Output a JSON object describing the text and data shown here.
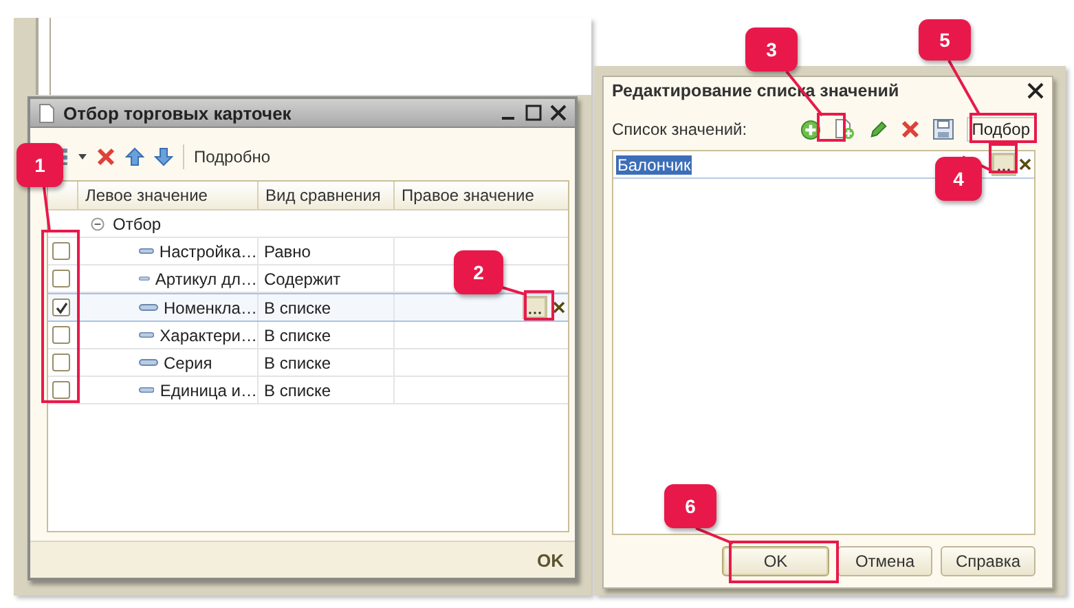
{
  "filter_window": {
    "title": "Отбор торговых карточек",
    "toolbar": {
      "details_button": "Подробно"
    },
    "table": {
      "columns": [
        "Левое значение",
        "Вид сравнения",
        "Правое значение"
      ],
      "group": {
        "label": "Отбор",
        "expanded": true
      },
      "rows": [
        {
          "checked": false,
          "left": "Настройка…",
          "comparison": "Равно",
          "right": "",
          "selected": false
        },
        {
          "checked": false,
          "left": "Артикул дл…",
          "comparison": "Содержит",
          "right": "",
          "selected": false
        },
        {
          "checked": true,
          "left": "Номенкла…",
          "comparison": "В списке",
          "right": "",
          "selected": true
        },
        {
          "checked": false,
          "left": "Характери…",
          "comparison": "В списке",
          "right": "",
          "selected": false
        },
        {
          "checked": false,
          "left": "Серия",
          "comparison": "В списке",
          "right": "",
          "selected": false
        },
        {
          "checked": false,
          "left": "Единица и…",
          "comparison": "В списке",
          "right": "",
          "selected": false
        }
      ]
    },
    "ok_button": "OK"
  },
  "list_window": {
    "title": "Редактирование списка значений",
    "label": "Список значений:",
    "pick_button": "Подбор",
    "items": [
      {
        "value": "Балончик",
        "selected": true
      }
    ],
    "buttons": [
      "OK",
      "Отмена",
      "Справка"
    ]
  },
  "callouts": [
    {
      "number": "1"
    },
    {
      "number": "2"
    },
    {
      "number": "3"
    },
    {
      "number": "4"
    },
    {
      "number": "5"
    },
    {
      "number": "6"
    }
  ]
}
